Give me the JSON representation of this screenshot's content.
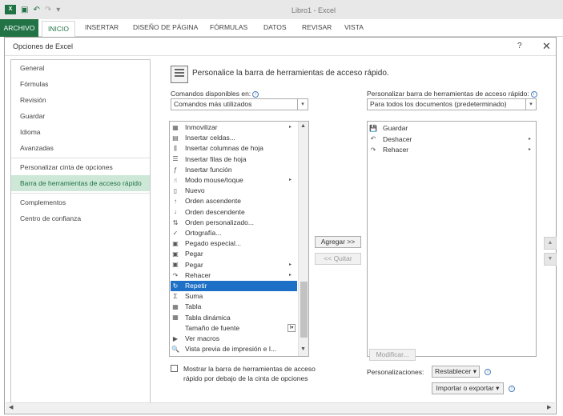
{
  "window": {
    "title": "Libro1 - Excel"
  },
  "ribbon": {
    "tabs": [
      "ARCHIVO",
      "INICIO",
      "INSERTAR",
      "DISEÑO DE PÁGINA",
      "FÓRMULAS",
      "DATOS",
      "REVISAR",
      "VISTA"
    ]
  },
  "dialog": {
    "title": "Opciones de Excel",
    "help": "?",
    "close": "✕",
    "nav": [
      "General",
      "Fórmulas",
      "Revisión",
      "Guardar",
      "Idioma",
      "Avanzadas",
      "Personalizar cinta de opciones",
      "Barra de herramientas de acceso rápido",
      "Complementos",
      "Centro de confianza"
    ],
    "header": "Personalice la barra de herramientas de acceso rápido.",
    "commands_label": "Comandos disponibles en:",
    "commands_select": "Comandos más utilizados",
    "customize_label": "Personalizar barra de herramientas de acceso rápido:",
    "customize_select": "Para todos los documentos (predeterminado)",
    "commands": [
      {
        "label": "Inmovilizar",
        "icon": "▦",
        "submenu": true
      },
      {
        "label": "Insertar celdas...",
        "icon": "▤"
      },
      {
        "label": "Insertar columnas de hoja",
        "icon": "⫼"
      },
      {
        "label": "Insertar filas de hoja",
        "icon": "☰"
      },
      {
        "label": "Insertar función",
        "icon": "ƒ"
      },
      {
        "label": "Modo mouse/toque",
        "icon": "☝",
        "submenu": true
      },
      {
        "label": "Nuevo",
        "icon": "▯"
      },
      {
        "label": "Orden ascendente",
        "icon": "↑"
      },
      {
        "label": "Orden descendente",
        "icon": "↓"
      },
      {
        "label": "Orden personalizado...",
        "icon": "⇅"
      },
      {
        "label": "Ortografía...",
        "icon": "✓"
      },
      {
        "label": "Pegado especial...",
        "icon": "▣"
      },
      {
        "label": "Pegar",
        "icon": "▣"
      },
      {
        "label": "Pegar",
        "icon": "▣",
        "submenu": true
      },
      {
        "label": "Rehacer",
        "icon": "↷",
        "submenu": true
      },
      {
        "label": "Repetir",
        "icon": "↻",
        "selected": true
      },
      {
        "label": "Suma",
        "icon": "Σ"
      },
      {
        "label": "Tabla",
        "icon": "▦"
      },
      {
        "label": "Tabla dinámica",
        "icon": "▦"
      },
      {
        "label": "Tamaño de fuente",
        "icon": "",
        "combo": "I▾"
      },
      {
        "label": "Ver macros",
        "icon": "▶"
      },
      {
        "label": "Vista previa de impresión e I...",
        "icon": "🔍"
      }
    ],
    "toolbar_items": [
      {
        "label": "Guardar",
        "icon": "💾"
      },
      {
        "label": "Deshacer",
        "icon": "↶",
        "submenu": true
      },
      {
        "label": "Rehacer",
        "icon": "↷",
        "submenu": true
      }
    ],
    "add_button": "Agregar >>",
    "remove_button": "<< Quitar",
    "modify_button": "Modificar...",
    "checkbox_label": "Mostrar la barra de herramientas de acceso rápido por debajo de la cinta de opciones",
    "personalizations_label": "Personalizaciones:",
    "reset_button": "Restablecer ▾",
    "import_export_button": "Importar o exportar ▾"
  }
}
